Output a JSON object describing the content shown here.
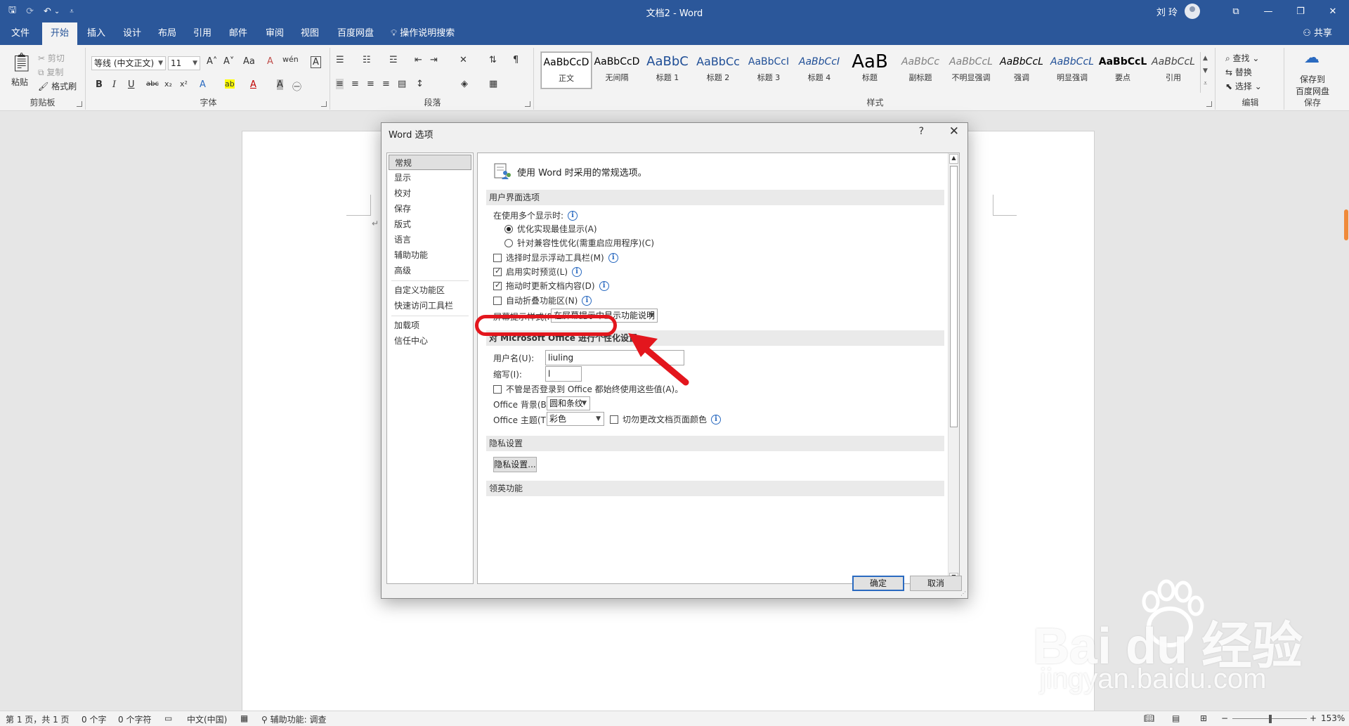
{
  "titlebar": {
    "doc_title": "文档2 - Word",
    "user": "刘 玲",
    "qat": {
      "save": "🖫",
      "redo": "⟳",
      "undo": "↶",
      "undo_arrow": "⌄",
      "customize": "⩡"
    },
    "win_buttons": {
      "ribbon_opts": "⧉",
      "minimize": "—",
      "restore": "❐",
      "close": "✕"
    }
  },
  "tabs": [
    "文件",
    "开始",
    "插入",
    "设计",
    "布局",
    "引用",
    "邮件",
    "审阅",
    "视图",
    "百度网盘"
  ],
  "active_tab": "开始",
  "tell_me": "操作说明搜索",
  "share": "共享",
  "ribbon": {
    "clipboard": {
      "label": "剪贴板",
      "paste": "粘贴",
      "cut": "剪切",
      "copy": "复制",
      "format_painter": "格式刷"
    },
    "font": {
      "label": "字体",
      "font_name": "等线 (中文正文)",
      "font_size": "11",
      "bold": "B",
      "italic": "I",
      "underline": "U",
      "strike": "abc",
      "sub": "x₂",
      "sup": "x²",
      "grow": "A˄",
      "shrink": "A˅",
      "case": "Aa",
      "clear": "A",
      "pinyin": "wén",
      "border_char": "A",
      "effects": "A",
      "highlight": "ab",
      "color": "A",
      "shade": "A",
      "circle": "㊀"
    },
    "paragraph": {
      "label": "段落"
    },
    "styles": {
      "label": "样式",
      "items": [
        {
          "sample": "AaBbCcD",
          "name": "正文"
        },
        {
          "sample": "AaBbCcD",
          "name": "无间隔"
        },
        {
          "sample": "AaBbC",
          "name": "标题 1"
        },
        {
          "sample": "AaBbCc",
          "name": "标题 2"
        },
        {
          "sample": "AaBbCcI",
          "name": "标题 3"
        },
        {
          "sample": "AaBbCcI",
          "name": "标题 4"
        },
        {
          "sample": "AaB",
          "name": "标题"
        },
        {
          "sample": "AaBbCc",
          "name": "副标题"
        },
        {
          "sample": "AaBbCcL",
          "name": "不明显强调"
        },
        {
          "sample": "AaBbCcL",
          "name": "强调"
        },
        {
          "sample": "AaBbCcL",
          "name": "明显强调"
        },
        {
          "sample": "AaBbCcL",
          "name": "要点"
        },
        {
          "sample": "AaBbCcL",
          "name": "引用"
        }
      ]
    },
    "editing": {
      "label": "编辑",
      "find": "查找",
      "replace": "替换",
      "select": "选择"
    },
    "save_group": {
      "label": "保存",
      "save_to": "保存到",
      "baidu": "百度网盘"
    }
  },
  "dialog": {
    "title": "Word 选项",
    "help": "?",
    "close": "✕",
    "nav": [
      "常规",
      "显示",
      "校对",
      "保存",
      "版式",
      "语言",
      "辅助功能",
      "高级",
      "自定义功能区",
      "快速访问工具栏",
      "加载项",
      "信任中心"
    ],
    "header": "使用 Word 时采用的常规选项。",
    "ui_section": "用户界面选项",
    "multi_display": "在使用多个显示时:",
    "opt_best": "优化实现最佳显示(A)",
    "opt_compat": "针对兼容性优化(需重启应用程序)(C)",
    "mini_toolbar": "选择时显示浮动工具栏(M)",
    "live_preview": "启用实时预览(L)",
    "drag_update": "拖动时更新文档内容(D)",
    "collapse_ribbon": "自动折叠功能区(N)",
    "screentip_label": "屏幕提示样式(R):",
    "screentip_value": "在屏幕提示中显示功能说明",
    "personalize_section": "对 Microsoft Office 进行个性化设置",
    "username_label": "用户名(U):",
    "username_value": "liuling",
    "initials_label": "缩写(I):",
    "initials_value": "l",
    "always_use": "不管是否登录到 Office 都始终使用这些值(A)。",
    "bg_label": "Office 背景(B):",
    "bg_value": "圆和条纹",
    "theme_label": "Office 主题(T):",
    "theme_value": "彩色",
    "never_change": "切勿更改文档页面颜色",
    "privacy_section": "隐私设置",
    "privacy_button": "隐私设置...",
    "linkedin_section": "领英功能",
    "ok": "确定",
    "cancel": "取消"
  },
  "status": {
    "page": "第 1 页，共 1 页",
    "words": "0 个字",
    "chars": "0 个字符",
    "lang": "中文(中国)",
    "accessibility": "辅助功能: 调查",
    "zoom": "153%"
  },
  "watermark": {
    "brand": "Bai  du 经验",
    "url": "jingyan.baidu.com"
  },
  "colors": {
    "title_blue": "#2b579a",
    "annotation_red": "#e3161d",
    "ribbon_bg": "#f3f3f3"
  }
}
